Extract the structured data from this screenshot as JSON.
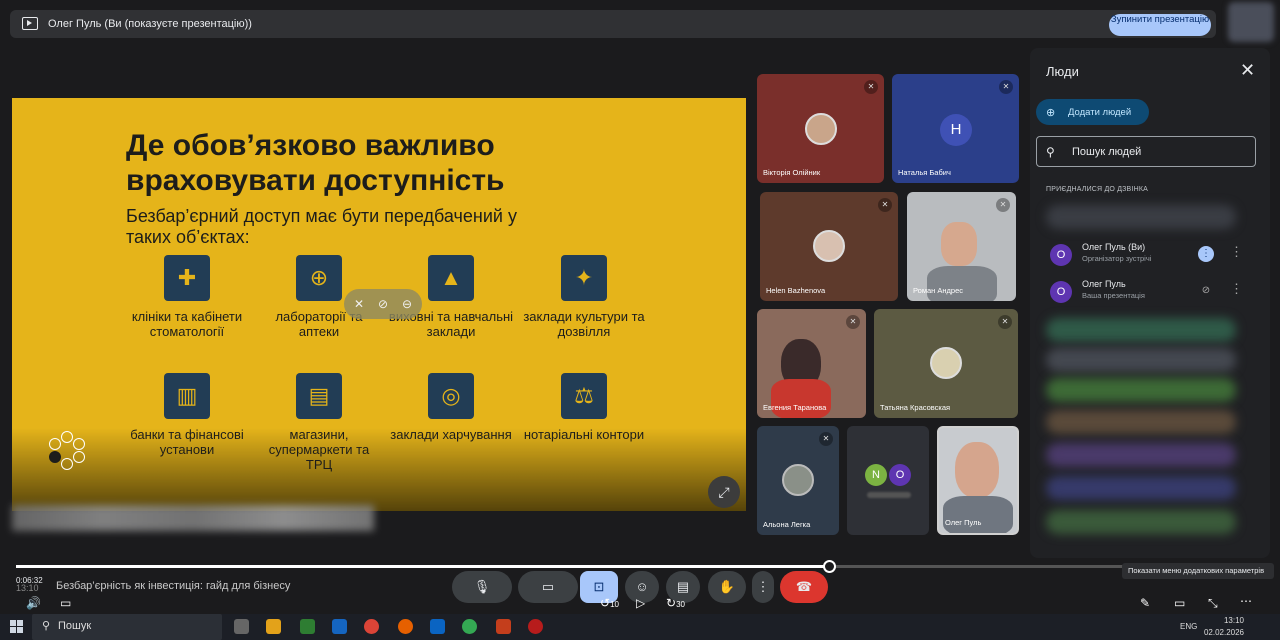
{
  "topbar": {
    "title": "Олег Пуль (Ви (показуєте презентацію))",
    "stop_label": "Зупинити презентацію"
  },
  "slide": {
    "title": "Де обов’язково важливо враховувати доступність",
    "subtitle": "Безбар’єрний доступ має бути передбачений у таких об’єктах:",
    "items": [
      {
        "label": "клініки та кабінети стоматології",
        "icon": "dental-chair-icon"
      },
      {
        "label": "лабораторії та аптеки",
        "icon": "pharmacy-icon"
      },
      {
        "label": "виховні та навчальні заклади",
        "icon": "graduation-cap-icon"
      },
      {
        "label": "заклади культури та дозвілля",
        "icon": "culture-icon"
      },
      {
        "label": "банки та фінансові установи",
        "icon": "bank-icon"
      },
      {
        "label": "магазини, супермаркети та ТРЦ",
        "icon": "shop-icon"
      },
      {
        "label": "заклади харчування",
        "icon": "food-icon"
      },
      {
        "label": "нотаріальні контори",
        "icon": "notary-icon"
      }
    ]
  },
  "tiles": [
    {
      "name": "Вікторія Олійник",
      "bg": "#7a2f2b"
    },
    {
      "name": "Наталья Бабич",
      "bg": "#2b3f8a",
      "initial": "Н"
    },
    {
      "name": "Helen Bazhenova",
      "bg": "#5e3a2c"
    },
    {
      "name": "Роман Андрес",
      "bg": "#b9bcbf"
    },
    {
      "name": "Евгения Таранова",
      "bg": "#8a6a5c"
    },
    {
      "name": "Татьяна Красовская",
      "bg": "#5c5a42"
    },
    {
      "name": "Альона Легка",
      "bg": "#2f3b4a"
    },
    {
      "name": "",
      "bg": "#2e3036",
      "initials": [
        "N",
        "O"
      ]
    },
    {
      "name": "Олег Пуль",
      "bg": "#c8cbcf"
    }
  ],
  "panel": {
    "title": "Люди",
    "add_label": "Додати людей",
    "search_placeholder": "Пошук людей",
    "section": "ПРИЄДНАЛИСЯ ДО ДЗВІНКА",
    "people": [
      {
        "initial": "О",
        "name": "Олег Пуль (Ви)",
        "role": "Організатор зустрічі"
      },
      {
        "initial": "О",
        "name": "Олег Пуль",
        "role": "Ваша презентація"
      }
    ]
  },
  "video": {
    "current_time": "0:06:32",
    "clock": "13:10",
    "title": "Безбар’єрність як інвестиція: гайд для бізнесу",
    "progress": 0.73,
    "tooltip": "Показати меню додаткових параметрів",
    "skip_back": "10",
    "skip_fwd": "30"
  },
  "taskbar": {
    "search": "Пошук",
    "lang": "ENG",
    "time": "13:10",
    "date": "02.02.2026"
  }
}
